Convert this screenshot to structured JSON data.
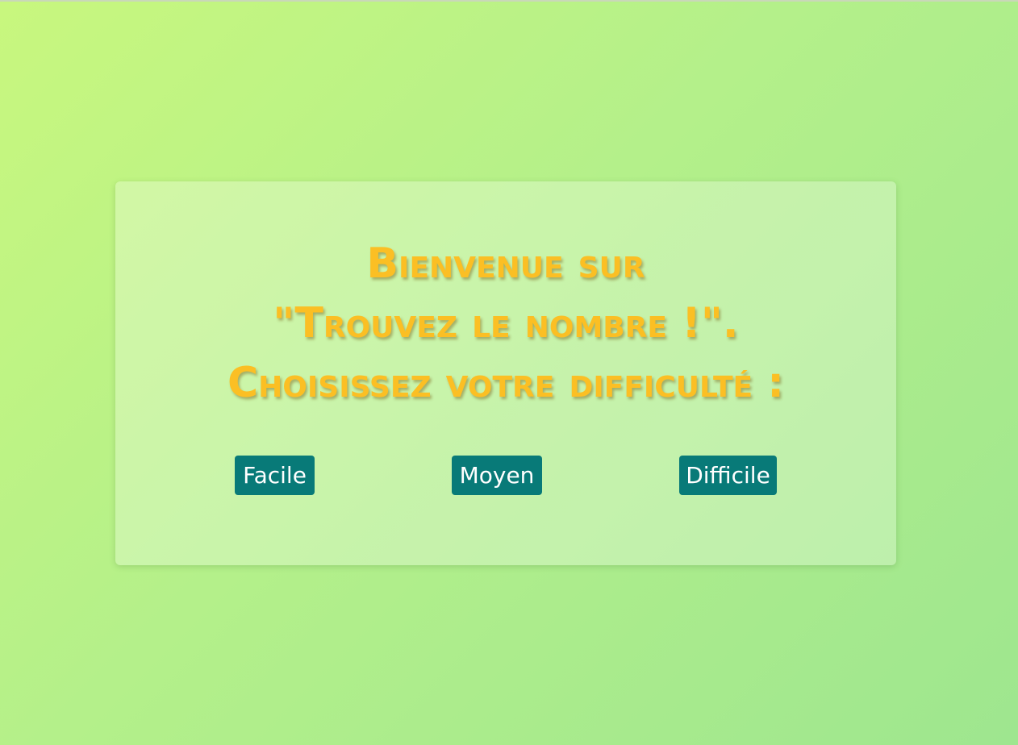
{
  "title": {
    "line1": "Bienvenue sur",
    "line2": "\"Trouvez le nombre !\".",
    "line3": "Choisissez votre difficulté :"
  },
  "buttons": {
    "easy": "Facile",
    "medium": "Moyen",
    "hard": "Difficile"
  },
  "colors": {
    "title": "#fbbf24",
    "button_bg": "#087a78",
    "button_text": "#ffffff",
    "background_start": "#c8f77e",
    "background_end": "#9ee68f"
  }
}
